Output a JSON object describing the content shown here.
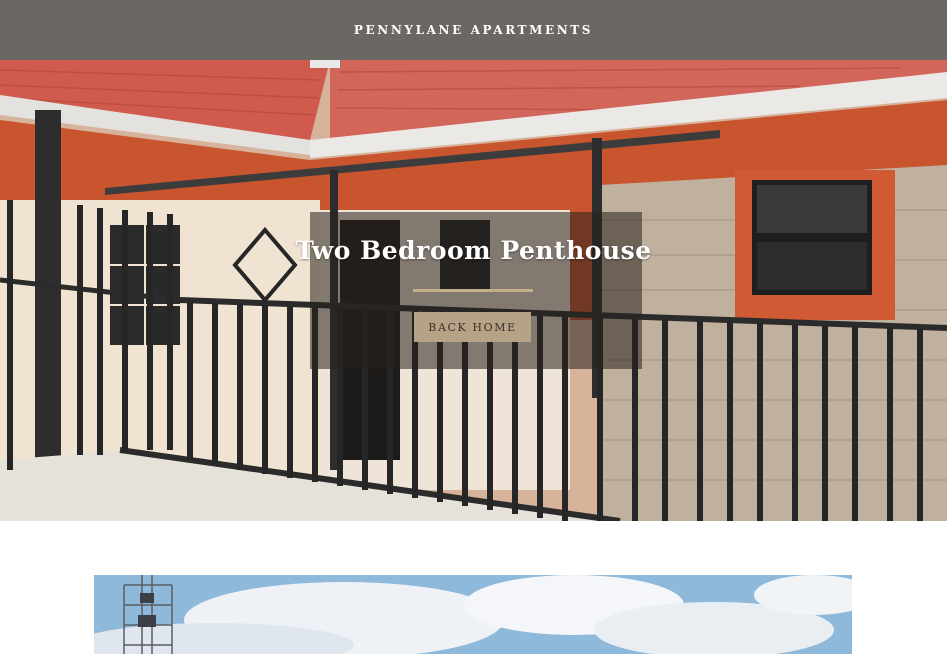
{
  "header": {
    "brand": "PENNYLANE APARTMENTS"
  },
  "hero": {
    "title": "Two Bedroom Penthouse",
    "button_label": "BACK HOME",
    "image_subject": "penthouse balcony with red tiled roof and black metal railing"
  },
  "gallery": {
    "image_subject": "sky with clouds and a telecom mast"
  },
  "colors": {
    "header_bg": "#6b6763",
    "accent": "#b6a287",
    "rule": "#c4ad8a"
  }
}
